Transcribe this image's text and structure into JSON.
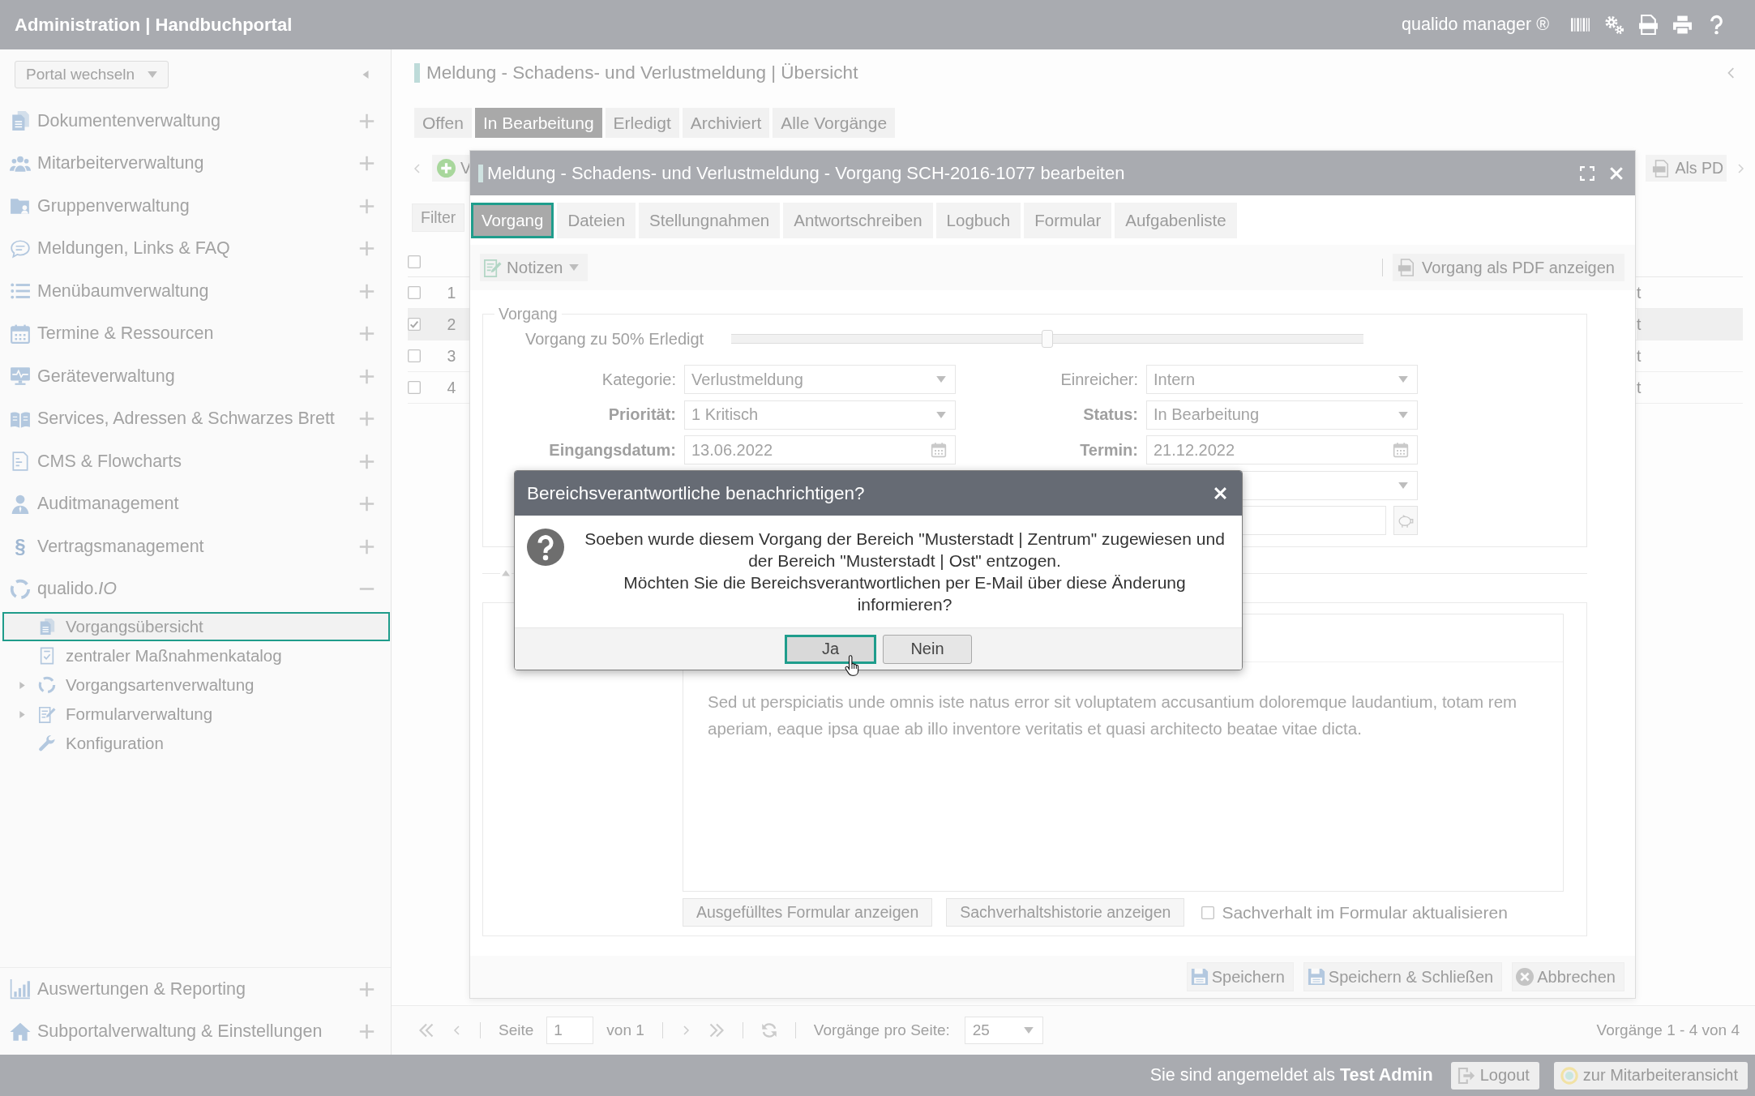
{
  "app_bar": {
    "title": "Administration | Handbuchportal",
    "product": "qualido manager ®"
  },
  "sidebar": {
    "portal_select": {
      "value": "Portal wechseln"
    },
    "items": [
      {
        "label": "Dokumentenverwaltung",
        "expanded": false
      },
      {
        "label": "Mitarbeiterverwaltung",
        "expanded": false
      },
      {
        "label": "Gruppenverwaltung",
        "expanded": false
      },
      {
        "label": "Meldungen, Links & FAQ",
        "expanded": false
      },
      {
        "label": "Menübaumverwaltung",
        "expanded": false
      },
      {
        "label": "Termine & Ressourcen",
        "expanded": false
      },
      {
        "label": "Geräteverwaltung",
        "expanded": false
      },
      {
        "label": "Services, Adressen & Schwarzes Brett",
        "expanded": false
      },
      {
        "label": "CMS & Flowcharts",
        "expanded": false
      },
      {
        "label": "Auditmanagement",
        "expanded": false
      },
      {
        "label": "Vertragsmanagement",
        "expanded": false,
        "icon_glyph": "§"
      },
      {
        "label": "qualido.*IO*",
        "expanded": true,
        "children": [
          {
            "label": "Vorgangsübersicht",
            "kind": "page",
            "selected": true
          },
          {
            "label": "zentraler Maßnahmenkatalog",
            "kind": "page",
            "selected": false
          },
          {
            "label": "Vorgangsartenverwaltung",
            "kind": "folder",
            "selected": false
          },
          {
            "label": "Formularverwaltung",
            "kind": "folder",
            "selected": false
          },
          {
            "label": "Konfiguration",
            "kind": "page",
            "selected": false
          }
        ]
      }
    ],
    "bottom_items": [
      {
        "label": "Auswertungen & Reporting",
        "expanded": false
      },
      {
        "label": "Subportalverwaltung & Einstellungen",
        "expanded": false
      }
    ]
  },
  "page": {
    "title": "Meldung - Schadens- und Verlustmeldung | Übersicht",
    "tabs": [
      {
        "label": "Offen",
        "selected": false
      },
      {
        "label": "In Bearbeitung",
        "selected": true
      },
      {
        "label": "Erledigt",
        "selected": false
      },
      {
        "label": "Archiviert",
        "selected": false
      },
      {
        "label": "Alle Vorgänge",
        "selected": false
      }
    ],
    "toolbar": {
      "add_button": "V",
      "pdf_button": "Als PD",
      "filter_button": "Filter"
    },
    "table": {
      "header_checkbox": {
        "checked": false
      },
      "rows": [
        {
          "number": "1",
          "checked": false,
          "selected": false,
          "column_3": "t"
        },
        {
          "number": "2",
          "checked": true,
          "selected": true,
          "column_3": "t"
        },
        {
          "number": "3",
          "checked": false,
          "selected": false,
          "column_3": "t"
        },
        {
          "number": "4",
          "checked": false,
          "selected": false,
          "column_3": "t"
        }
      ]
    },
    "pagination": {
      "page_label": "Seite",
      "page_value": "1",
      "page_total": "von 1",
      "per_page_label": "Vorgänge pro Seite:",
      "per_page_value": "25",
      "summary": "Vorgänge 1 - 4 von 4"
    }
  },
  "edit_window": {
    "title": "Meldung - Schadens- und Verlustmeldung - Vorgang SCH-2016-1077 bearbeiten",
    "tabs": [
      {
        "label": "Vorgang",
        "selected": true
      },
      {
        "label": "Dateien",
        "selected": false
      },
      {
        "label": "Stellungnahmen",
        "selected": false
      },
      {
        "label": "Antwortschreiben",
        "selected": false
      },
      {
        "label": "Logbuch",
        "selected": false
      },
      {
        "label": "Formular",
        "selected": false
      },
      {
        "label": "Aufgabenliste",
        "selected": false
      }
    ],
    "toolbar": {
      "notes_button": "Notizen",
      "pdf_button": "Vorgang als PDF anzeigen"
    },
    "details": {
      "legend": "Vorgang",
      "progress": {
        "label": "Vorgang zu 50% Erledigt",
        "level": 0.5
      },
      "fields": [
        {
          "label": "Kategorie:",
          "value": "Verlustmeldung",
          "kind": "select",
          "required": false
        },
        {
          "label": "Einreicher:",
          "value": "Intern",
          "kind": "select",
          "required": false
        },
        {
          "label": "Priorität:",
          "value": "1 Kritisch",
          "kind": "select",
          "required": true
        },
        {
          "label": "Status:",
          "value": "In Bearbeitung",
          "kind": "select",
          "required": true
        },
        {
          "label": "Eingangsdatum:",
          "value": "13.06.2022",
          "kind": "date",
          "required": true
        },
        {
          "label": "Termin:",
          "value": "21.12.2022",
          "kind": "date",
          "required": true
        }
      ]
    },
    "description": {
      "text": "Sed ut perspiciatis unde omnis iste natus error sit voluptatem accusantium doloremque laudantium, totam rem aperiam, eaque ipsa quae ab illo inventore veritatis et quasi architecto beatae vitae dicta.",
      "buttons": [
        "Ausgefülltes Formular anzeigen",
        "Sachverhaltshistorie anzeigen"
      ],
      "update_form": {
        "label": "Sachverhalt im Formular aktualisieren",
        "checked": false
      }
    },
    "footer_buttons": [
      "Speichern",
      "Speichern & Schließen",
      "Abbrechen"
    ]
  },
  "confirm_dialog": {
    "title": "Bereichsverantwortliche benachrichtigen?",
    "message": [
      "Soeben wurde diesem Vorgang der Bereich \"Musterstadt | Zentrum\" zugewiesen und der Bereich \"Musterstadt | Ost\" entzogen.",
      "Möchten Sie die Bereichsverantwortlichen per E-Mail über diese Änderung informieren?"
    ],
    "buttons": [
      {
        "label": "Ja",
        "focused": true
      },
      {
        "label": "Nein",
        "focused": false
      }
    ]
  },
  "status_bar": {
    "login_text": "Sie sind angemeldet als **Test Admin**",
    "buttons": [
      "Logout",
      "zur Mitarbeiteransicht"
    ]
  }
}
